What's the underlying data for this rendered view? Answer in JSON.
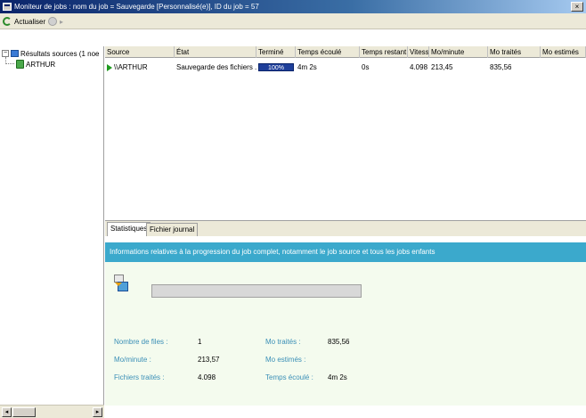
{
  "window": {
    "title": "Moniteur de jobs : nom du job = Sauvegarde [Personnalisé(e)], ID du job = 57",
    "close_glyph": "×"
  },
  "toolbar": {
    "refresh_label": "Actualiser",
    "nav_icon": "circle-arrow-icon"
  },
  "tree": {
    "root_label": "Résultats sources (1 noe",
    "child_label": "ARTHUR"
  },
  "grid": {
    "columns": [
      "Source",
      "État",
      "Terminé",
      "Temps écoulé",
      "Temps restant",
      "Vitess...",
      "Mo/minute",
      "Mo traités",
      "Mo estimés"
    ],
    "rows": [
      {
        "source": "\\\\ARTHUR",
        "state": "Sauvegarde des fichiers ...",
        "completed": "100%",
        "completed_fraction": 1.0,
        "elapsed": "4m 2s",
        "remaining": "0s",
        "speed": "4.098",
        "mb_per_min": "213,45",
        "mb_processed": "835,56",
        "mb_estimated": ""
      }
    ]
  },
  "details": {
    "tabs": [
      "Statistiques",
      "Fichier journal"
    ],
    "banner": "Informations relatives à la progression du job complet, notamment le job source et tous les jobs enfants",
    "stats": {
      "files_label": "Nombre de files :",
      "files_value": "1",
      "mbmin_label": "Mo/minute :",
      "mbmin_value": "213,57",
      "processed_label": "Fichiers traités :",
      "processed_value": "4.098",
      "mbdone_label": "Mo traités :",
      "mbdone_value": "835,56",
      "mbest_label": "Mo estimés :",
      "mbest_value": "",
      "elapsed_label": "Temps écoulé :",
      "elapsed_value": "4m 2s"
    }
  }
}
